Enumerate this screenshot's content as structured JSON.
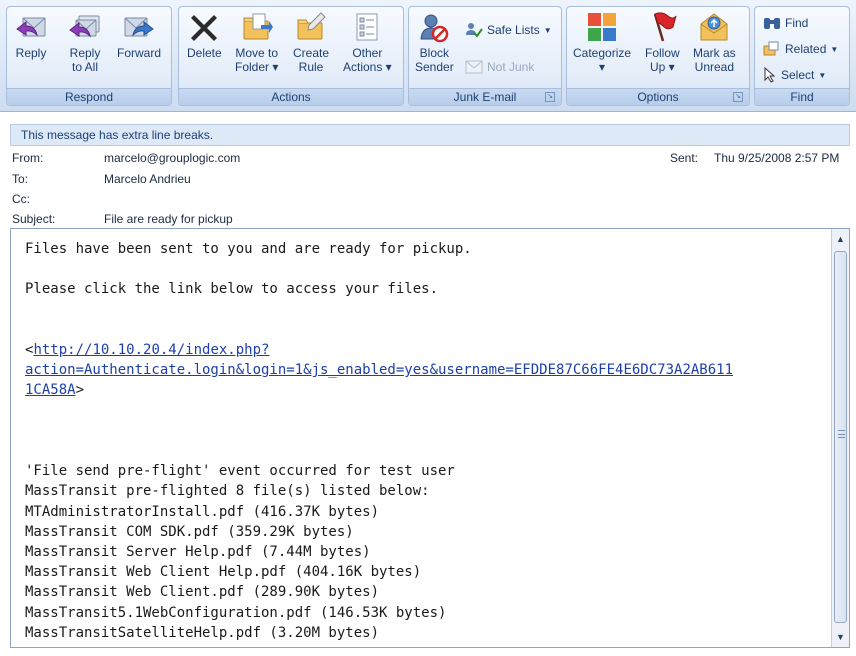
{
  "ribbon": {
    "respond": {
      "label": "Respond",
      "reply": "Reply",
      "reply_all": "Reply\nto All",
      "forward": "Forward"
    },
    "actions": {
      "label": "Actions",
      "delete": "Delete",
      "move_to_folder": "Move to\nFolder ▾",
      "create_rule": "Create\nRule",
      "other_actions": "Other\nActions ▾"
    },
    "junk": {
      "label": "Junk E-mail",
      "block_sender": "Block\nSender",
      "safe_lists": "Safe Lists",
      "not_junk": "Not Junk"
    },
    "options": {
      "label": "Options",
      "categorize": "Categorize\n▾",
      "follow_up": "Follow\nUp ▾",
      "mark_unread": "Mark as\nUnread"
    },
    "find": {
      "label": "Find",
      "find": "Find",
      "related": "Related",
      "select": "Select"
    }
  },
  "infobar": {
    "text": "This message has extra line breaks."
  },
  "headers": {
    "from_label": "From:",
    "from": "marcelo@grouplogic.com",
    "to_label": "To:",
    "to": "Marcelo Andrieu",
    "cc_label": "Cc:",
    "cc": "",
    "subject_label": "Subject:",
    "subject": "File are ready for pickup",
    "sent_label": "Sent:",
    "sent": "Thu 9/25/2008 2:57 PM"
  },
  "message": {
    "line1": "Files have been sent to you and are ready for pickup.",
    "line2": "Please click the link below to access your files.",
    "link_open": "<",
    "link_line1": "http://10.10.20.4/index.php?",
    "link_line2": "action=Authenticate.login&login=1&js_enabled=yes&username=EFDDE87C66FE4E6DC73A2AB611",
    "link_line3": "1CA58A",
    "link_close": ">",
    "event": "'File send pre-flight' event occurred for test user",
    "summary": "MassTransit pre-flighted 8 file(s) listed below:",
    "files": [
      "MTAdministratorInstall.pdf (416.37K bytes)",
      "MassTransit COM SDK.pdf (359.29K bytes)",
      "MassTransit Server Help.pdf (7.44M bytes)",
      "MassTransit Web Client Help.pdf (404.16K bytes)",
      "MassTransit Web Client.pdf (289.90K bytes)",
      "MassTransit5.1WebConfiguration.pdf (146.53K bytes)",
      "MassTransitSatelliteHelp.pdf (3.20M bytes)"
    ]
  }
}
